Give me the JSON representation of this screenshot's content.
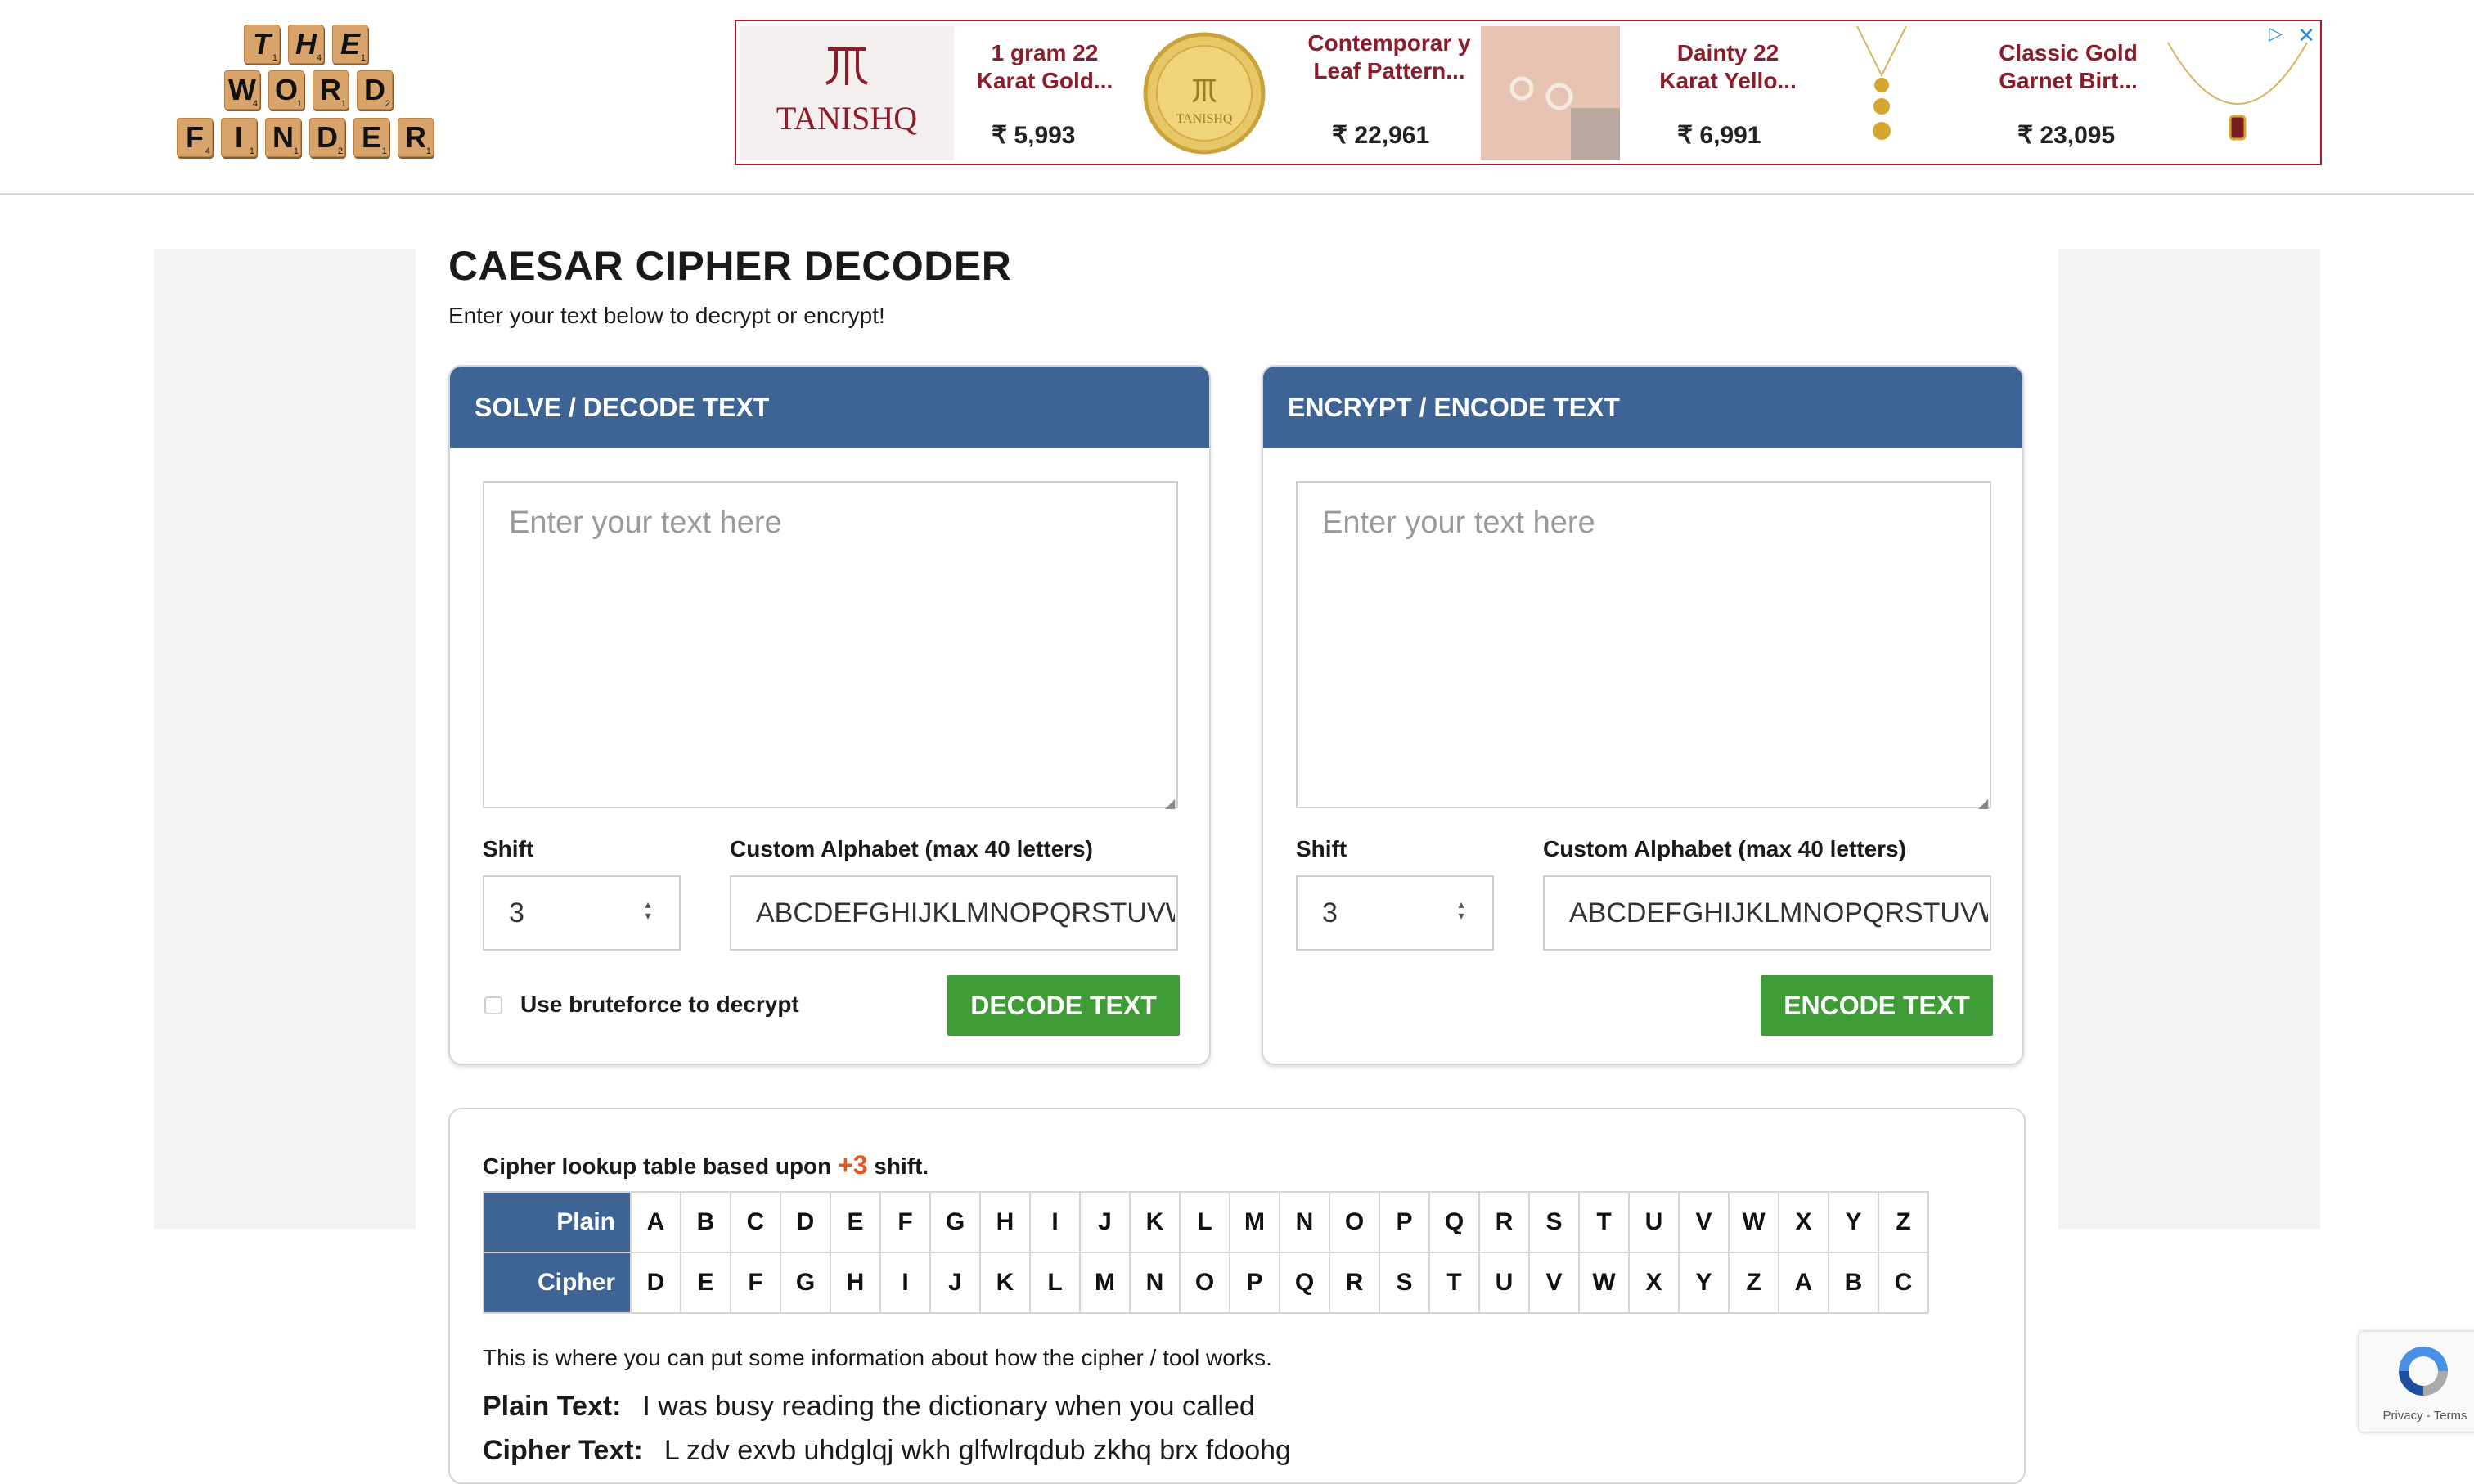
{
  "logo": {
    "rows": [
      [
        {
          "l": "T",
          "p": "1"
        },
        {
          "l": "H",
          "p": "4"
        },
        {
          "l": "E",
          "p": "1"
        }
      ],
      [
        {
          "l": "W",
          "p": "4"
        },
        {
          "l": "O",
          "p": "1"
        },
        {
          "l": "R",
          "p": "1"
        },
        {
          "l": "D",
          "p": "2"
        }
      ],
      [
        {
          "l": "F",
          "p": "4"
        },
        {
          "l": "I",
          "p": "1"
        },
        {
          "l": "N",
          "p": "1"
        },
        {
          "l": "D",
          "p": "2"
        },
        {
          "l": "E",
          "p": "1"
        },
        {
          "l": "R",
          "p": "1"
        }
      ]
    ]
  },
  "ad": {
    "brand": "TANISHQ",
    "items": [
      {
        "title": "1 gram 22 Karat Gold...",
        "price": "₹ 5,993"
      },
      {
        "title": "Contemporar y Leaf Pattern...",
        "price": "₹ 22,961"
      },
      {
        "title": "Dainty 22 Karat Yello...",
        "price": "₹ 6,991"
      },
      {
        "title": "Classic Gold Garnet Birt...",
        "price": "₹ 23,095"
      }
    ],
    "close_icon": "close-icon",
    "adchoices_icon": "adchoices-icon",
    "accent_color": "#8c1c2a"
  },
  "page": {
    "title": "CAESAR CIPHER DECODER",
    "subtitle": "Enter your text below to decrypt or encrypt!"
  },
  "decode": {
    "header": "SOLVE / DECODE TEXT",
    "placeholder": "Enter your text here",
    "shift_label": "Shift",
    "shift_value": "3",
    "alphabet_label": "Custom Alphabet (max 40 letters)",
    "alphabet_value": "ABCDEFGHIJKLMNOPQRSTUVWXYZ",
    "bruteforce_label": "Use bruteforce to decrypt",
    "button": "DECODE TEXT"
  },
  "encode": {
    "header": "ENCRYPT / ENCODE TEXT",
    "placeholder": "Enter your text here",
    "shift_label": "Shift",
    "shift_value": "3",
    "alphabet_label": "Custom Alphabet (max 40 letters)",
    "alphabet_value": "ABCDEFGHIJKLMNOPQRSTUVWXYZ",
    "button": "ENCODE TEXT"
  },
  "lookup": {
    "title_prefix": "Cipher lookup table based upon ",
    "shift_text": "+3",
    "title_suffix": " shift.",
    "plain_label": "Plain",
    "cipher_label": "Cipher",
    "plain": [
      "A",
      "B",
      "C",
      "D",
      "E",
      "F",
      "G",
      "H",
      "I",
      "J",
      "K",
      "L",
      "M",
      "N",
      "O",
      "P",
      "Q",
      "R",
      "S",
      "T",
      "U",
      "V",
      "W",
      "X",
      "Y",
      "Z"
    ],
    "cipher": [
      "D",
      "E",
      "F",
      "G",
      "H",
      "I",
      "J",
      "K",
      "L",
      "M",
      "N",
      "O",
      "P",
      "Q",
      "R",
      "S",
      "T",
      "U",
      "V",
      "W",
      "X",
      "Y",
      "Z",
      "A",
      "B",
      "C"
    ],
    "info": "This is where you can put some information about how the cipher / tool works.",
    "plain_text_label": "Plain Text:",
    "plain_text": "I was busy reading the dictionary when you called",
    "cipher_text_label": "Cipher Text:",
    "cipher_text": "L zdv exvb uhdglqj wkh glfwlrqdub zkhq brx fdoohg"
  },
  "recaptcha": {
    "privacy": "Privacy",
    "separator": " - ",
    "terms": "Terms"
  },
  "colors": {
    "panel_header": "#3e6496",
    "button_green": "#3f9b35",
    "shift_highlight": "#e2561f"
  }
}
